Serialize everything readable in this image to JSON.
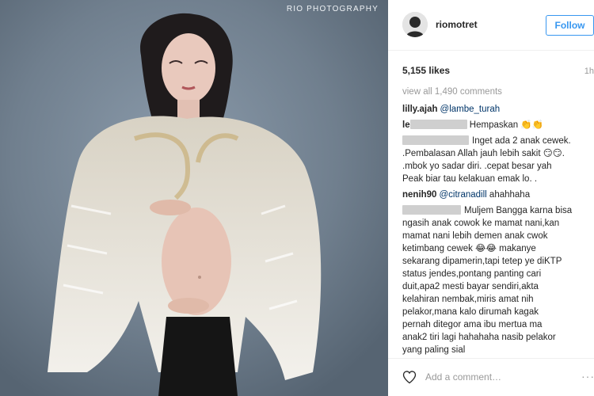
{
  "photo": {
    "watermark": "RIO PHOTOGRAPHY",
    "alt_subject": "portrait"
  },
  "header": {
    "username": "riomotret",
    "follow_label": "Follow"
  },
  "stats": {
    "likes": "5,155 likes",
    "time": "1h"
  },
  "comments": {
    "view_all": "view all 1,490 comments",
    "items": [
      {
        "user": "lilly.ajah",
        "mention": "@lambe_turah"
      },
      {
        "user_prefix": "le",
        "text": " Hempaskan 👏👏"
      },
      {
        "lines": [
          "Inget ada 2 anak cewek.",
          ".Pembalasan Allah jauh lebih sakit 😏😏.",
          ".mbok yo sadar diri. .cepat besar yah",
          "Peak biar tau kelakuan emak lo. ."
        ]
      },
      {
        "user": "nenih90",
        "mention": "@citranadill",
        "text": " ahahhaha"
      },
      {
        "first": "Muljem Bangga karna bisa",
        "lines": [
          "ngasih anak cowok ke mamat nani,kan",
          "mamat nani lebih demen anak cwok",
          "ketimbang cewek 😂😂 makanye",
          "sekarang dipamerin,tapi tetep ye diKTP",
          "status jendes,pontang panting cari",
          "duit,apa2 mesti bayar sendiri,akta",
          "kelahiran nembak,miris amat nih",
          "pelakor,mana kalo dirumah kagak",
          "pernah ditegor ama ibu mertua ma",
          "anak2 tiri lagi hahahaha nasib pelakor",
          "yang paling sial"
        ]
      }
    ]
  },
  "footer": {
    "add_comment_placeholder": "Add a comment…",
    "more_label": "···"
  },
  "icons": {
    "heart": "heart-icon",
    "more": "more-options-icon"
  }
}
